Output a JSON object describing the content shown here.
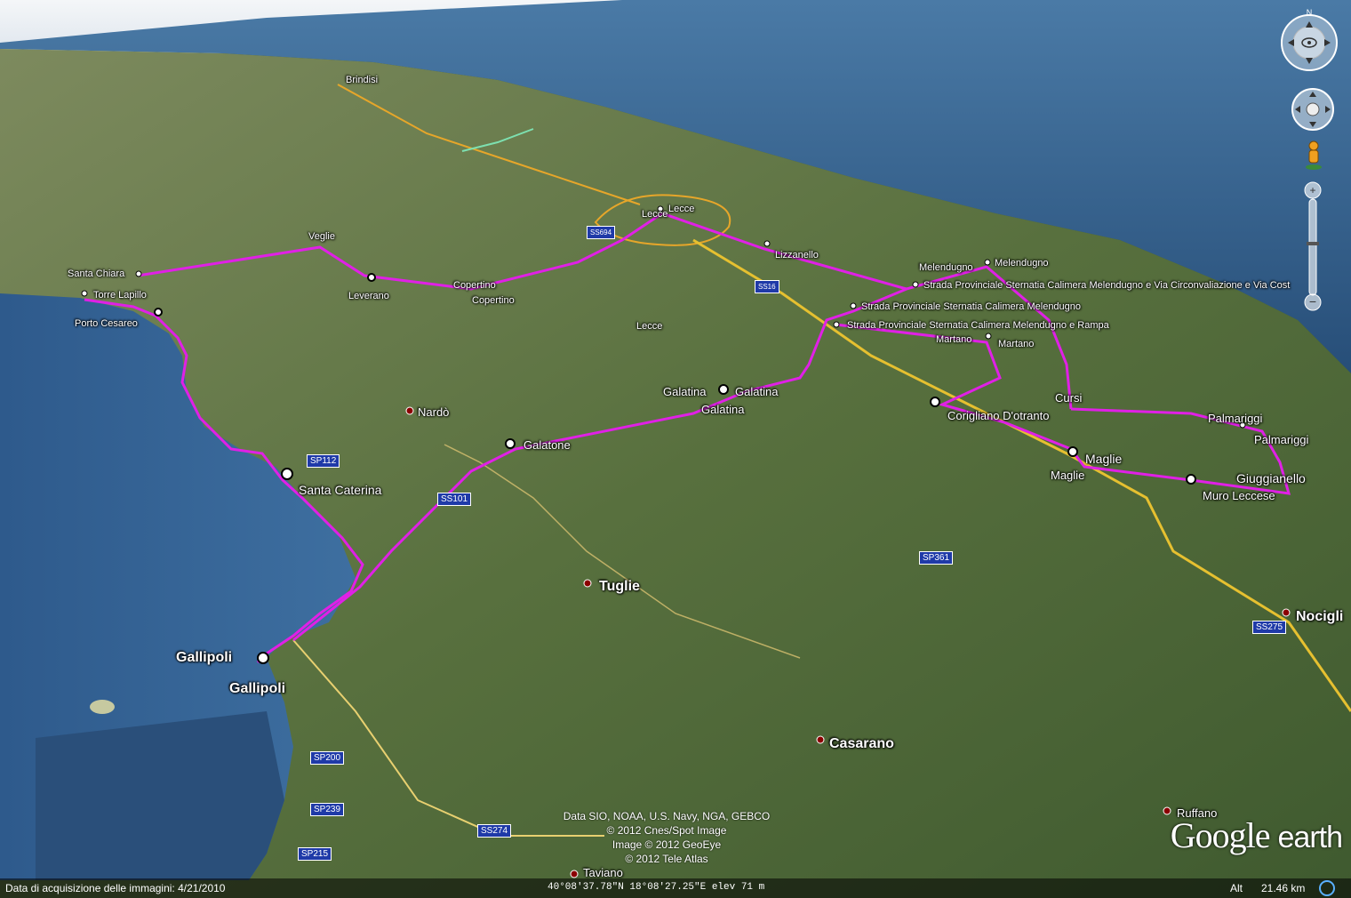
{
  "places": [
    {
      "id": "brindisi",
      "label": "Brindisi"
    },
    {
      "id": "santa-chiara",
      "label": "Santa Chiara"
    },
    {
      "id": "torre-lapillo",
      "label": "Torre Lapillo"
    },
    {
      "id": "porto-cesareo",
      "label": "Porto Cesareo"
    },
    {
      "id": "veglie",
      "label": "Veglie"
    },
    {
      "id": "leverano",
      "label": "Leverano"
    },
    {
      "id": "copertino-1",
      "label": "Copertino"
    },
    {
      "id": "copertino-2",
      "label": "Copertino"
    },
    {
      "id": "lecce-1",
      "label": "Lecce"
    },
    {
      "id": "lecce-2",
      "label": "Lecce"
    },
    {
      "id": "lecce-3",
      "label": "Lecce"
    },
    {
      "id": "lizzanello",
      "label": "Lizzanello"
    },
    {
      "id": "melendugno-1",
      "label": "Melendugno"
    },
    {
      "id": "melendugno-2",
      "label": "Melendugno"
    },
    {
      "id": "sp-1",
      "label": "Strada Provinciale Sternatia Calimera Melendugno e Via Circonvaliazione e Via Cost"
    },
    {
      "id": "sp-2",
      "label": "Strada Provinciale Sternatia Calimera Melendugno"
    },
    {
      "id": "sp-3",
      "label": "Strada Provinciale Sternatia Calimera Melendugno e Rampa"
    },
    {
      "id": "martano-1",
      "label": "Martano"
    },
    {
      "id": "martano-2",
      "label": "Martano"
    },
    {
      "id": "nardo",
      "label": "Nardò"
    },
    {
      "id": "galatina-1",
      "label": "Galatina"
    },
    {
      "id": "galatina-2",
      "label": "Galatina"
    },
    {
      "id": "galatina-3",
      "label": "Galatina"
    },
    {
      "id": "galatone",
      "label": "Galatone"
    },
    {
      "id": "corigliano",
      "label": "Corigliano D'otranto"
    },
    {
      "id": "cursi",
      "label": "Cursi"
    },
    {
      "id": "palmariggi-1",
      "label": "Palmariggi"
    },
    {
      "id": "palmariggi-2",
      "label": "Palmariggi"
    },
    {
      "id": "maglie-1",
      "label": "Maglie"
    },
    {
      "id": "maglie-2",
      "label": "Maglie"
    },
    {
      "id": "giuggianello",
      "label": "Giuggianello"
    },
    {
      "id": "muro-leccese",
      "label": "Muro Leccese"
    },
    {
      "id": "santa-caterina",
      "label": "Santa Caterina"
    },
    {
      "id": "tuglie",
      "label": "Tuglie"
    },
    {
      "id": "nociglia",
      "label": "Nocigli"
    },
    {
      "id": "gallipoli-1",
      "label": "Gallipoli"
    },
    {
      "id": "gallipoli-2",
      "label": "Gallipoli"
    },
    {
      "id": "casarano",
      "label": "Casarano"
    },
    {
      "id": "ruffano",
      "label": "Ruffano"
    },
    {
      "id": "taviano",
      "label": "Taviano"
    }
  ],
  "roads": [
    "SS694",
    "SS16",
    "SP112",
    "SS101",
    "SP361",
    "SS275",
    "SP200",
    "SP239",
    "SS274",
    "SP215"
  ],
  "credits": [
    "Data SIO, NOAA, U.S. Navy, NGA, GEBCO",
    "© 2012 Cnes/Spot Image",
    "Image © 2012 GeoEye",
    "© 2012 Tele Atlas"
  ],
  "logo": {
    "brand": "Google",
    "product": "earth"
  },
  "status": {
    "acquisition_label": "Data di acquisizione delle immagini: 4/21/2010",
    "coordinates": "40°08'37.78\"N  18°08'27.25\"E  elev    71 m",
    "alt_label": "Alt",
    "alt_value": "21.46 km"
  },
  "controls": {
    "north_label": "N"
  },
  "colors": {
    "route": "#e020e6",
    "road_major": "#e8b030",
    "sea": "#2e5a86",
    "land": "#4f6b38",
    "shield": "#1f3aa8"
  }
}
